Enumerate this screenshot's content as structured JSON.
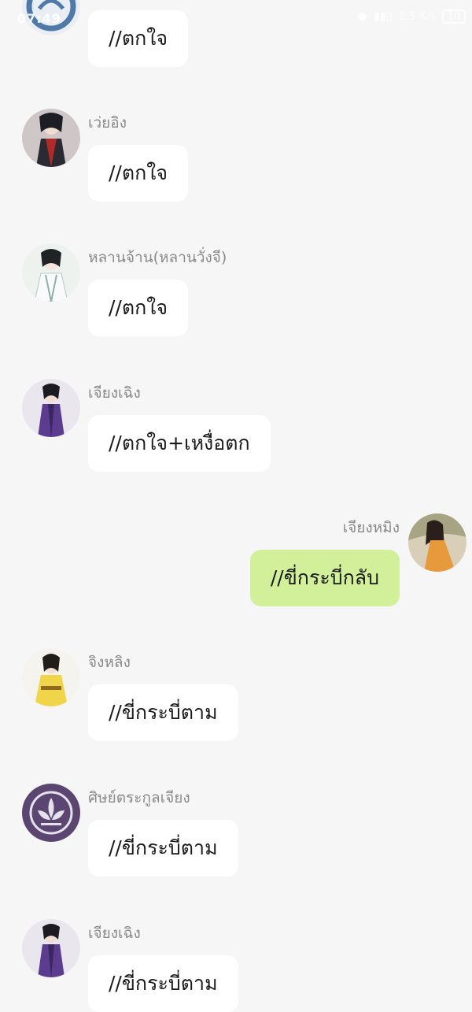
{
  "status_bar": {
    "time": "07:49",
    "network_speed": "1.5 K/s",
    "battery": "10"
  },
  "messages": [
    {
      "sender": "",
      "text": "//ตกใจ",
      "side": "left",
      "avatar_icon": "dragon-emblem-avatar"
    },
    {
      "sender": "เว่ยอิง",
      "text": "//ตกใจ",
      "side": "left",
      "avatar_icon": "wei-ying-avatar"
    },
    {
      "sender": "หลานจ้าน(หลานวั่งจี)",
      "text": "//ตกใจ",
      "side": "left",
      "avatar_icon": "lan-zhan-avatar"
    },
    {
      "sender": "เจียงเฉิง",
      "text": "//ตกใจ+เหงื่อตก",
      "side": "left",
      "avatar_icon": "jiang-cheng-avatar"
    },
    {
      "sender": "เจียงหมิง",
      "text": "//ขี่กระบี่กลับ",
      "side": "right",
      "avatar_icon": "jiang-ming-avatar"
    },
    {
      "sender": "จิงหลิง",
      "text": "//ขี่กระบี่ตาม",
      "side": "left",
      "avatar_icon": "jin-ling-avatar"
    },
    {
      "sender": "ศิษย์ตระกูลเจียง",
      "text": "//ขี่กระบี่ตาม",
      "side": "left",
      "avatar_icon": "lotus-emblem-avatar"
    },
    {
      "sender": "เจียงเฉิง",
      "text": "//ขี่กระบี่ตาม",
      "side": "left",
      "avatar_icon": "jiang-cheng-avatar"
    }
  ],
  "colors": {
    "background": "#f6f6f6",
    "incoming_bubble": "#ffffff",
    "outgoing_bubble": "#d2f09a",
    "name_text": "#8a8a8a"
  }
}
